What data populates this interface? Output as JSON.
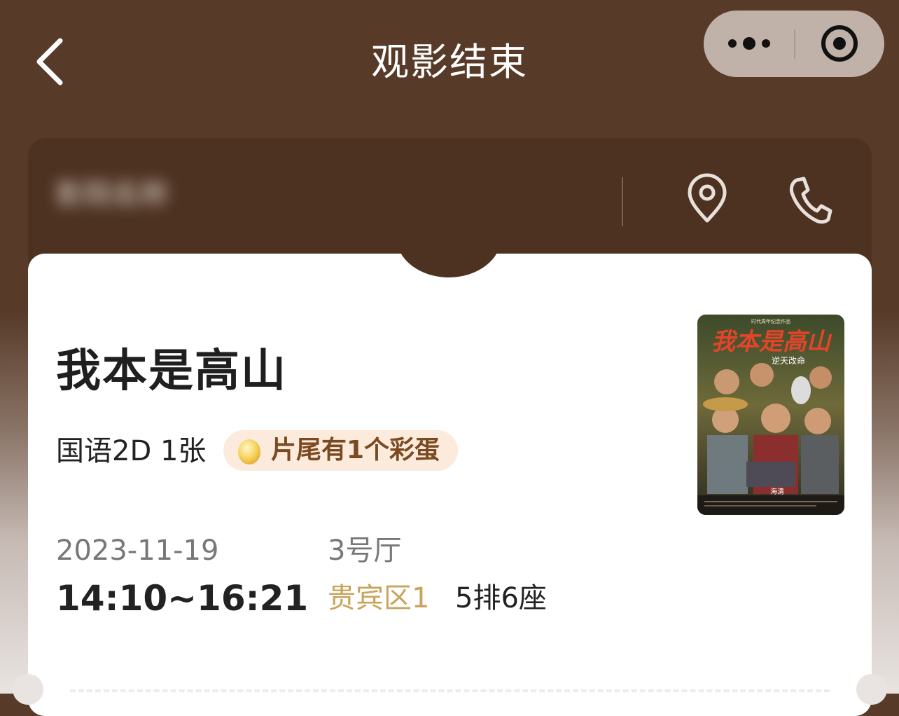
{
  "nav": {
    "title": "观影结束",
    "back_icon": "chevron-left-icon",
    "more_icon": "more-dots-icon",
    "close_icon": "target-circle-icon"
  },
  "cinema": {
    "name": "影院名称",
    "location_icon": "location-pin-icon",
    "phone_icon": "phone-icon"
  },
  "ticket": {
    "movie_title": "我本是高山",
    "meta": "国语2D 1张",
    "easter_egg": "片尾有1个彩蛋",
    "date": "2023-11-19",
    "time": "14:10~16:21",
    "hall": "3号厅",
    "zone": "贵宾区1",
    "seat": "5排6座",
    "poster": {
      "title_art": "我本是高山",
      "tagline": "逆天改命",
      "director": "海清"
    }
  },
  "colors": {
    "header_bg": "#573a28",
    "card_bg": "#4d3221",
    "zone_gold": "#c8a45a",
    "egg_badge_bg": "#fcebdc"
  }
}
